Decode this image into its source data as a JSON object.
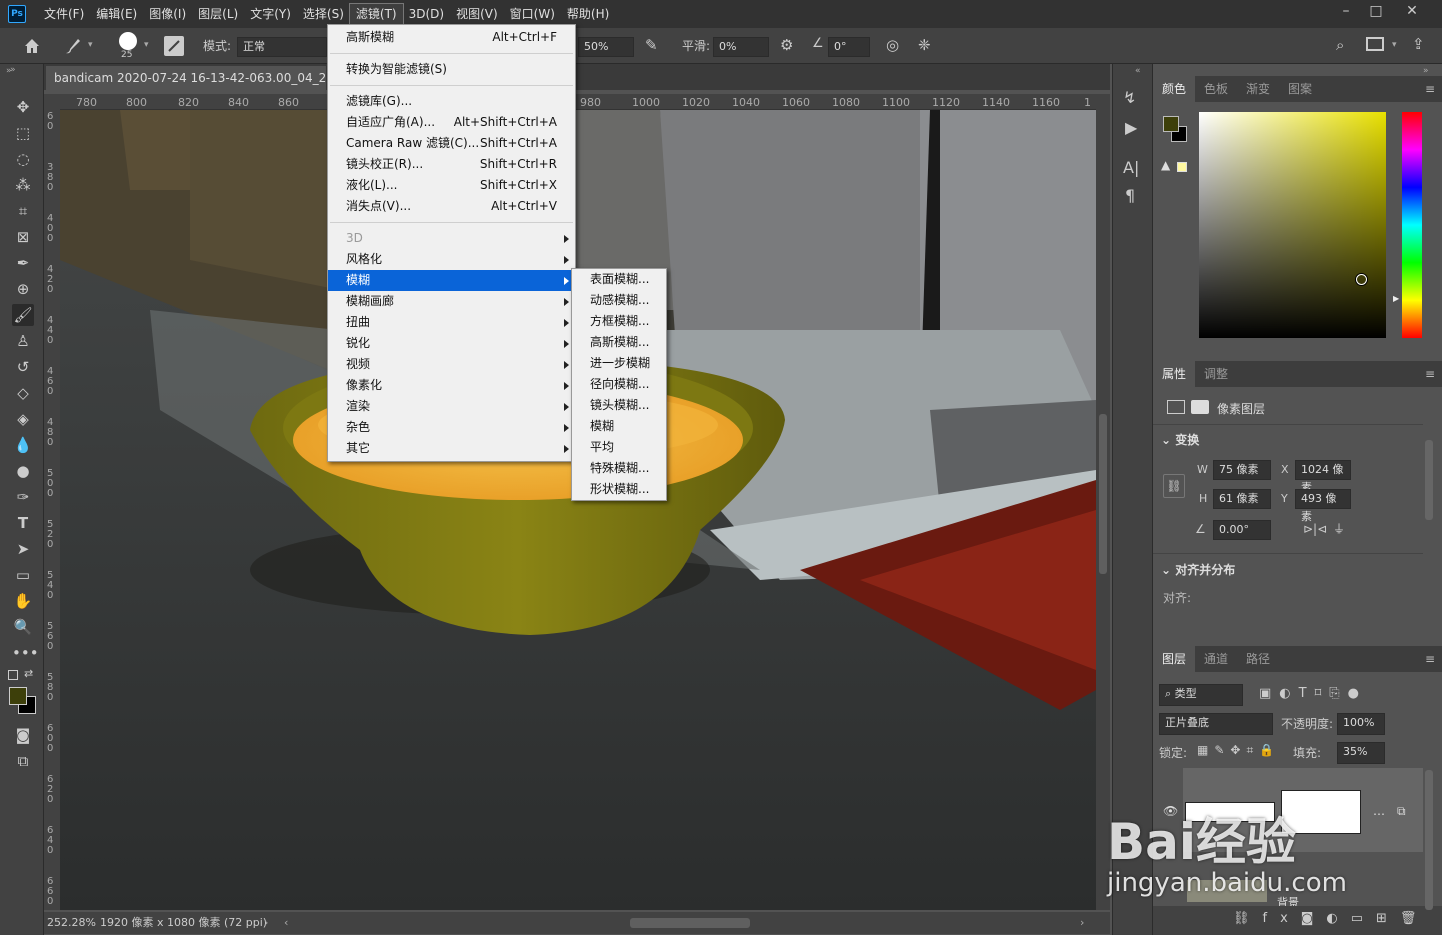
{
  "app": {
    "logo": "Ps"
  },
  "menubar": [
    "文件(F)",
    "编辑(E)",
    "图像(I)",
    "图层(L)",
    "文字(Y)",
    "选择(S)",
    "滤镜(T)",
    "3D(D)",
    "视图(V)",
    "窗口(W)",
    "帮助(H)"
  ],
  "options": {
    "brush_size": "25",
    "mode_label": "模式:",
    "mode_value": "正常",
    "opacity_value": "50%",
    "smooth_label": "平滑:",
    "smooth_value": "0%",
    "angle_value": "0°"
  },
  "document": {
    "tab_title": "bandicam 2020-07-24 16-13-42-063.00_04_25_24.S",
    "zoom": "252.28%",
    "info": "1920 像素 x 1080 像素 (72 ppi)"
  },
  "ruler_h": [
    "780",
    "800",
    "820",
    "840",
    "860",
    "980",
    "1000",
    "1020",
    "1040",
    "1060",
    "1080",
    "1100",
    "1120",
    "1140",
    "1160",
    "1"
  ],
  "ruler_v": [
    "6 0",
    "3 8 0",
    "4 0 0",
    "4 2 0",
    "4 4 0",
    "4 6 0",
    "4 8 0",
    "5 0 0",
    "5 2 0",
    "5 4 0",
    "5 6 0",
    "5 8 0",
    "6 0 0",
    "6 2 0",
    "6 4 0",
    "6 6 0"
  ],
  "filter_menu": {
    "items": [
      {
        "label": "高斯模糊",
        "shortcut": "Alt+Ctrl+F"
      },
      {
        "sep": true
      },
      {
        "label": "转换为智能滤镜(S)"
      },
      {
        "sep": true
      },
      {
        "label": "滤镜库(G)..."
      },
      {
        "label": "自适应广角(A)...",
        "shortcut": "Alt+Shift+Ctrl+A"
      },
      {
        "label": "Camera Raw 滤镜(C)...",
        "shortcut": "Shift+Ctrl+A"
      },
      {
        "label": "镜头校正(R)...",
        "shortcut": "Shift+Ctrl+R"
      },
      {
        "label": "液化(L)...",
        "shortcut": "Shift+Ctrl+X"
      },
      {
        "label": "消失点(V)...",
        "shortcut": "Alt+Ctrl+V"
      },
      {
        "sep": true
      },
      {
        "label": "3D",
        "sub": true,
        "disabled": true
      },
      {
        "label": "风格化",
        "sub": true
      },
      {
        "label": "模糊",
        "sub": true,
        "highlight": true
      },
      {
        "label": "模糊画廊",
        "sub": true
      },
      {
        "label": "扭曲",
        "sub": true
      },
      {
        "label": "锐化",
        "sub": true
      },
      {
        "label": "视频",
        "sub": true
      },
      {
        "label": "像素化",
        "sub": true
      },
      {
        "label": "渲染",
        "sub": true
      },
      {
        "label": "杂色",
        "sub": true
      },
      {
        "label": "其它",
        "sub": true
      }
    ]
  },
  "blur_submenu": [
    "表面模糊...",
    "动感模糊...",
    "方框模糊...",
    "高斯模糊...",
    "进一步模糊",
    "径向模糊...",
    "镜头模糊...",
    "模糊",
    "平均",
    "特殊模糊...",
    "形状模糊..."
  ],
  "color_panel": {
    "tabs": [
      "颜色",
      "色板",
      "渐变",
      "图案"
    ],
    "fg_color": "#3d3f0a",
    "bg_color": "#000000"
  },
  "properties_panel": {
    "tabs": [
      "属性",
      "调整"
    ],
    "layer_type": "像素图层",
    "transform_title": "变换",
    "w_label": "W",
    "w_value": "75 像素",
    "x_label": "X",
    "x_value": "1024 像素",
    "h_label": "H",
    "h_value": "61 像素",
    "y_label": "Y",
    "y_value": "493 像素",
    "angle_value": "0.00°",
    "align_title": "对齐并分布",
    "align_label": "对齐:"
  },
  "layers_panel": {
    "tabs": [
      "图层",
      "通道",
      "路径"
    ],
    "filter_kind": "类型",
    "blend_mode": "正片叠底",
    "opacity_label": "不透明度:",
    "opacity_value": "100%",
    "lock_label": "锁定:",
    "fill_label": "填充:",
    "fill_value": "35%",
    "bg_layer_name": "背景"
  },
  "watermark": {
    "brand": "Bai经验",
    "url": "jingyan.baidu.com"
  }
}
